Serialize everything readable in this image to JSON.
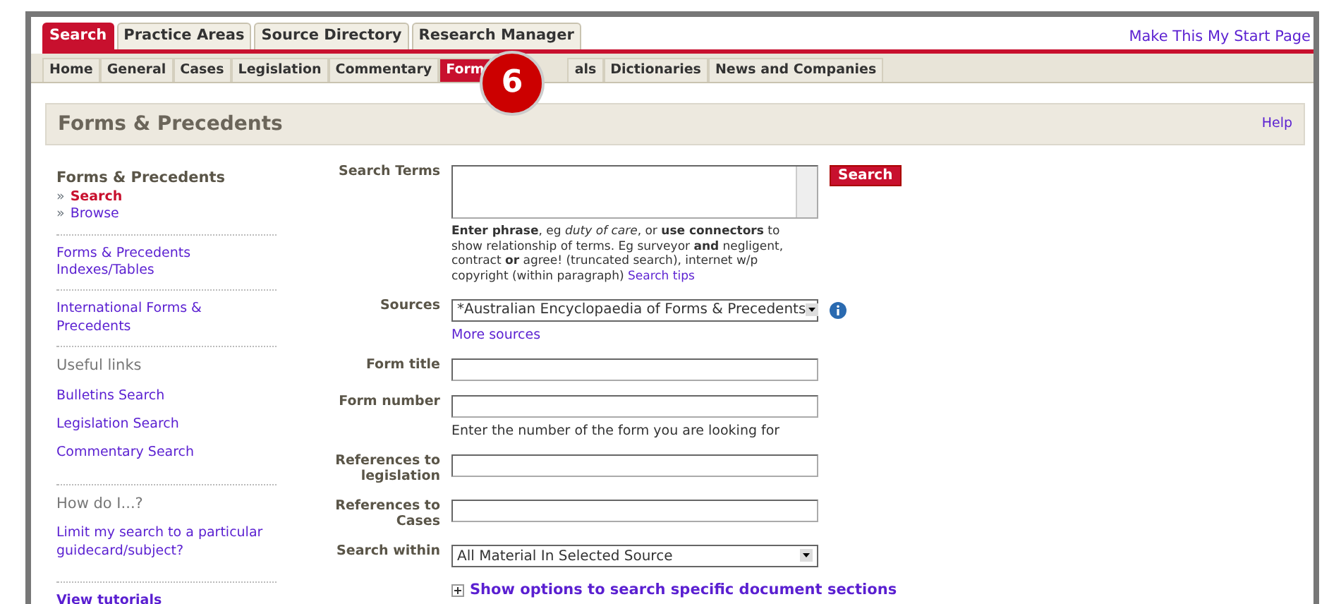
{
  "top_link": "Make This My Start Page",
  "main_tabs": [
    {
      "label": "Search",
      "selected": true
    },
    {
      "label": "Practice Areas",
      "selected": false
    },
    {
      "label": "Source Directory",
      "selected": false
    },
    {
      "label": "Research Manager",
      "selected": false
    }
  ],
  "sub_tabs": [
    {
      "label": "Home",
      "selected": false
    },
    {
      "label": "General",
      "selected": false
    },
    {
      "label": "Cases",
      "selected": false
    },
    {
      "label": "Legislation",
      "selected": false
    },
    {
      "label": "Commentary",
      "selected": false
    },
    {
      "label": "Form",
      "selected": true
    },
    {
      "label": "als",
      "selected": false
    },
    {
      "label": "Dictionaries",
      "selected": false
    },
    {
      "label": "News and Companies",
      "selected": false
    }
  ],
  "step_badge": "6",
  "page_title": "Forms & Precedents",
  "help_link": "Help",
  "sidebar": [
    {
      "kind": "nav",
      "title": "Forms & Precedents",
      "bullet": "»",
      "items": [
        {
          "label": "Search",
          "selected": true
        },
        {
          "label": "Browse",
          "selected": false
        }
      ]
    },
    {
      "kind": "link",
      "label": "Forms & Precedents Indexes/Tables"
    },
    {
      "kind": "link",
      "label": "International Forms & Precedents"
    },
    {
      "kind": "group",
      "title": "Useful links",
      "items": [
        "Bulletins Search",
        "Legislation Search",
        "Commentary Search"
      ]
    },
    {
      "kind": "group",
      "title": "How do I...?",
      "items": [
        "Limit my search to a particular guidecard/subject?"
      ]
    },
    {
      "kind": "strong",
      "label": "View tutorials"
    }
  ],
  "form": [
    {
      "kind": "textarea",
      "label": "Search Terms",
      "button": "Search",
      "hint": "**Enter phrase**, eg *duty of care*, or **use connectors** to show relationship of terms. Eg surveyor **and** negligent, contract **or** agree! (truncated search), internet w/p copyright (within paragraph)",
      "hint_link": "Search tips"
    },
    {
      "kind": "select",
      "label": "Sources",
      "value": "*Australian Encyclopaedia of Forms & Precedents",
      "info": true,
      "link": "More sources"
    },
    {
      "kind": "text",
      "label": "Form title"
    },
    {
      "kind": "text",
      "label": "Form number",
      "note": "Enter the number of the form you are looking for"
    },
    {
      "kind": "text",
      "label": "References to legislation"
    },
    {
      "kind": "text",
      "label": "References to Cases"
    },
    {
      "kind": "select",
      "label": "Search within",
      "value": "All Material In Selected Source"
    }
  ],
  "options_link": "Show options to search specific document sections"
}
